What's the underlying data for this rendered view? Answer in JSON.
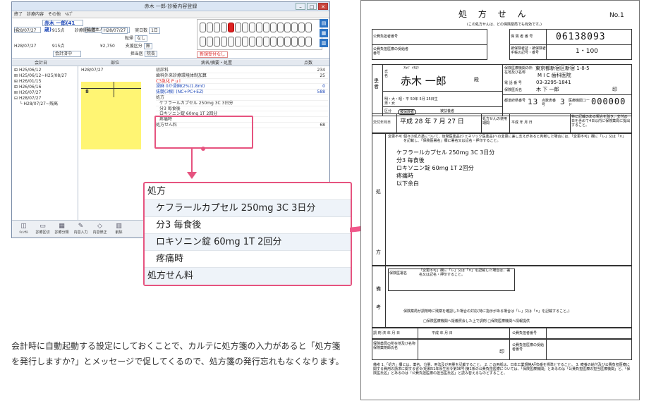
{
  "app": {
    "title": "赤木 一郎-診療内容登録",
    "menu": [
      "終了",
      "診療内容",
      "その他",
      "ﾍﾙﾌﾟ"
    ],
    "patient": {
      "id": "1",
      "name": "赤木 一郎(41歳)",
      "insurance_type": "社保本人(30%)",
      "visit_date": "H28/07/27",
      "date_1": "H28/07/27",
      "amount_1": "915点",
      "date_2": "H28/07/27",
      "amount_2": "915点",
      "amount_yen": "¥2,750",
      "status": "会計済中",
      "first_visit_label": "診療開始日",
      "first_visit": "H28/07/27",
      "days_label": "実日数",
      "days": "1日",
      "transfer_label": "転帰",
      "transfer": "なし",
      "copay_label": "支援区分",
      "copay": "無",
      "doctor_label": "担当医",
      "doctor": "院長"
    },
    "notice": "新規受付なし",
    "columns": {
      "history": "会計日",
      "site": "部位",
      "treatment": "病名/摘要・処置",
      "points": "点数"
    },
    "history_tree": [
      "H25/06/12",
      "H25/06/12~H25/08/27",
      "H26/01/15",
      "H26/06/16",
      "H26/07/27",
      "H28/07/27",
      "H28/07/27~残高"
    ],
    "karte_date": "H28/07/27",
    "karte_lines": [
      {
        "text": "初診料",
        "points": "234",
        "color": "normal"
      },
      {
        "text": "歯科外来診療環境体制加算",
        "points": "25",
        "color": "normal"
      },
      {
        "text": "C3急化 P u l",
        "points": "",
        "color": "red"
      },
      {
        "text": "浸麻 0か浸麻(2%)1.8ml)",
        "points": "0",
        "color": "blue"
      },
      {
        "text": "抜髄(3根) (NC+PC+EZ)",
        "points": "588",
        "color": "blue"
      },
      {
        "text": "処方",
        "points": "",
        "color": "normal"
      },
      {
        "text": "ケフラールカプセル 250mg 3C 3日分",
        "points": "",
        "color": "normal"
      },
      {
        "text": "分3 毎食後",
        "points": "",
        "color": "normal"
      },
      {
        "text": "ロキソニン錠 60mg 1T 2回分",
        "points": "",
        "color": "normal"
      },
      {
        "text": "疼痛時",
        "points": "",
        "color": "normal"
      },
      {
        "text": "処方せん料",
        "points": "68",
        "color": "normal"
      }
    ],
    "yellow_mark": "8",
    "toolbar": [
      "ｷｬﾝｾﾙ",
      "診療区切",
      "診療分類",
      "内容入力",
      "内容修正",
      "削除"
    ]
  },
  "callout": {
    "lines": [
      "処方",
      "ケフラールカプセル 250mg 3C 3日分",
      "分3 毎食後",
      "ロキソニン錠 60mg 1T 2回分",
      "疼痛時",
      "処方せん料"
    ]
  },
  "caption": "会計時に自動起動する設定にしておくことで、カルテに処方箋の入力があると「処方箋を発行しますか?」とメッセージで促してくるので、処方箋の発行忘れもなくなります。",
  "rx": {
    "title": "処 方 せ ん",
    "number": "No.1",
    "subtitle": "(この処方せんは、どの保険薬局でも有効です。)",
    "public_payer_label": "公費負担者番号",
    "public_recipient_label": "公費負担医療の受給者番号",
    "insurer_label": "保 険 者 番 号",
    "insurer_number": "06138093",
    "card_label": "被保険者証・被保険者手帳の記号・番号",
    "card_number": "1・100",
    "patient_label": "患 者",
    "name_label": "氏名",
    "furigana": "ｱｶｷﾞ ｲﾁﾛｳ",
    "patient_name": "赤木 一郎",
    "honorific": "殿",
    "birth": "明・大・昭・平 50年 5月 25日生",
    "sex": "男・女",
    "class_label": "区分",
    "class_1": "被保険者",
    "class_2": "被扶養者",
    "clinic_label": "保険医療機関の所在地及び名称",
    "clinic_address": "東京都新宿区新宿 1-8-5",
    "clinic_name": "M I C 歯科医院",
    "phone_label": "電 話 番 号",
    "phone": "03-3295-1841",
    "doctor_label": "保険医氏名",
    "doctor": "木 下 一郎",
    "seal": "印",
    "pref_label": "都道府県番号",
    "pref_number": "13",
    "score_label": "点数表番号",
    "score_number": "3",
    "code_label": "医療機関コード",
    "code": "000000",
    "issue_label": "交付年月日",
    "issue_date": "平成 28 年 7 月 27 日",
    "validity_label": "処方せんの使用期間",
    "validity": "平成 年 月 日",
    "validity_note": "特に記載のある場合を除き、交付の日を含めて4日以内に保険薬局に提出すること。",
    "generic_note": "個々の処方薬について、後発医薬品(ジェネリック医薬品)への変更に差し支えがあると判断した場合には、「変更不可」欄に「レ」又は「×」を記載し、「保険医署名」欄に署名又は記名・押印すること。",
    "change_label": "変更不可",
    "rx_label": "処 方",
    "rx_lines": [
      "ケフラールカプセル 250mg 3C 3日分",
      "分3 毎食後",
      "ロキソニン錠 60mg 1T 2回分",
      "疼痛時",
      "以下余白"
    ],
    "remarks_label": "備 考",
    "sign_label": "保険医署名",
    "sign_note": "「変更不可」欄に「レ」又は「×」を記載した場合は、署名又は記名・押印すること。",
    "stock_note": "保険薬局が調剤時に残薬を確認した場合の対応(特に指示がある場合は「レ」又は「×」を記載すること。)",
    "stock_options": "□保険医療機関へ疑義照会した上で調剤  □保険医療機関へ情報提供",
    "dispense_label": "調 剤 済 年 月 日",
    "dispense_date": "平成 年 月 日",
    "public_payer_label_2": "公費負担者番号",
    "pharmacy_label": "保険薬局の所在地及び名称 保険薬剤師氏名",
    "seal2": "印",
    "recipient_label_2": "公費負担医療の受給者番号",
    "footnotes": "備考 1.「処方」欄には、薬名、分量、用法及び用量を記載すること。 2. この用紙は、日本工業規格A列5番を標準とすること。 3. 療養の給付及び公費負担医療に関する費用の請求に関する省令(昭和51年厚生省令第36号)第1条の公費負担医療については、「保険医療機関」とあるのは「公費負担医療の担当医療機関」と、「保険医氏名」とあるのは「公費負担医療の担当医氏名」と読み替えるものとすること。"
  },
  "colors": {
    "accent": "#e6537f",
    "karte_yellow": "#fff573",
    "blue": "#2d74c4"
  }
}
